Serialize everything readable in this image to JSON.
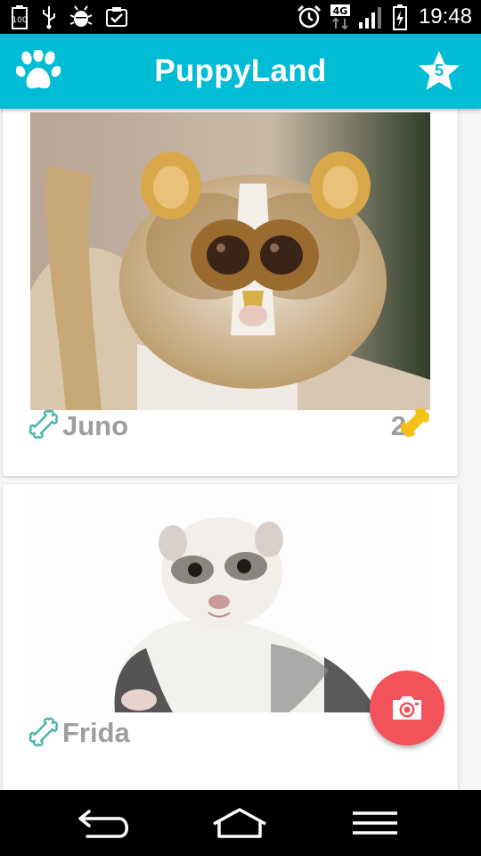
{
  "status_bar": {
    "time": "19:48",
    "network": "4G",
    "icons": [
      "battery-100-icon",
      "usb-icon",
      "android-debug-icon",
      "clipboard-check-icon",
      "alarm-icon",
      "network-4g-icon",
      "signal-icon",
      "battery-charging-icon"
    ]
  },
  "toolbar": {
    "title": "PuppyLand",
    "left_icon": "paw-icon",
    "star_count": "5"
  },
  "feed": {
    "posts": [
      {
        "name": "Juno",
        "likes": "2",
        "photo": "slow-loris-photo"
      },
      {
        "name": "Frida",
        "likes": "",
        "photo": "ferret-photo"
      }
    ]
  },
  "fab": {
    "icon": "camera-icon"
  },
  "nav_bar": {
    "buttons": [
      "back-icon",
      "home-icon",
      "menu-icon"
    ]
  },
  "colors": {
    "primary": "#00bcd4",
    "accent": "#f2525a",
    "bone_outline": "#4db6ac",
    "bone_filled": "#f5c116",
    "name_text": "#9e9e9e"
  }
}
